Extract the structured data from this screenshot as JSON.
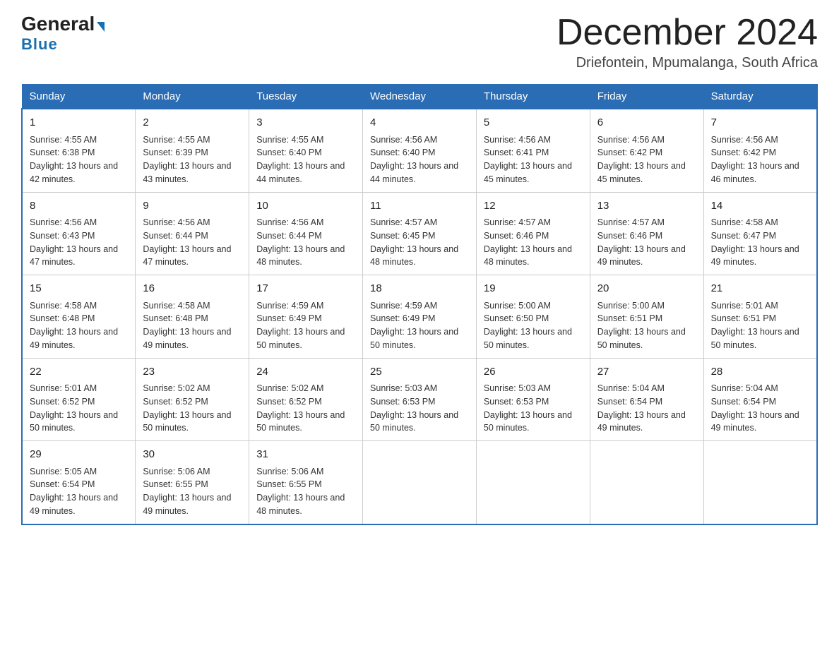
{
  "header": {
    "logo_general": "General",
    "logo_blue": "Blue",
    "month_year": "December 2024",
    "location": "Driefontein, Mpumalanga, South Africa"
  },
  "days_of_week": [
    "Sunday",
    "Monday",
    "Tuesday",
    "Wednesday",
    "Thursday",
    "Friday",
    "Saturday"
  ],
  "weeks": [
    [
      {
        "day": 1,
        "sunrise": "4:55 AM",
        "sunset": "6:38 PM",
        "daylight": "13 hours and 42 minutes."
      },
      {
        "day": 2,
        "sunrise": "4:55 AM",
        "sunset": "6:39 PM",
        "daylight": "13 hours and 43 minutes."
      },
      {
        "day": 3,
        "sunrise": "4:55 AM",
        "sunset": "6:40 PM",
        "daylight": "13 hours and 44 minutes."
      },
      {
        "day": 4,
        "sunrise": "4:56 AM",
        "sunset": "6:40 PM",
        "daylight": "13 hours and 44 minutes."
      },
      {
        "day": 5,
        "sunrise": "4:56 AM",
        "sunset": "6:41 PM",
        "daylight": "13 hours and 45 minutes."
      },
      {
        "day": 6,
        "sunrise": "4:56 AM",
        "sunset": "6:42 PM",
        "daylight": "13 hours and 45 minutes."
      },
      {
        "day": 7,
        "sunrise": "4:56 AM",
        "sunset": "6:42 PM",
        "daylight": "13 hours and 46 minutes."
      }
    ],
    [
      {
        "day": 8,
        "sunrise": "4:56 AM",
        "sunset": "6:43 PM",
        "daylight": "13 hours and 47 minutes."
      },
      {
        "day": 9,
        "sunrise": "4:56 AM",
        "sunset": "6:44 PM",
        "daylight": "13 hours and 47 minutes."
      },
      {
        "day": 10,
        "sunrise": "4:56 AM",
        "sunset": "6:44 PM",
        "daylight": "13 hours and 48 minutes."
      },
      {
        "day": 11,
        "sunrise": "4:57 AM",
        "sunset": "6:45 PM",
        "daylight": "13 hours and 48 minutes."
      },
      {
        "day": 12,
        "sunrise": "4:57 AM",
        "sunset": "6:46 PM",
        "daylight": "13 hours and 48 minutes."
      },
      {
        "day": 13,
        "sunrise": "4:57 AM",
        "sunset": "6:46 PM",
        "daylight": "13 hours and 49 minutes."
      },
      {
        "day": 14,
        "sunrise": "4:58 AM",
        "sunset": "6:47 PM",
        "daylight": "13 hours and 49 minutes."
      }
    ],
    [
      {
        "day": 15,
        "sunrise": "4:58 AM",
        "sunset": "6:48 PM",
        "daylight": "13 hours and 49 minutes."
      },
      {
        "day": 16,
        "sunrise": "4:58 AM",
        "sunset": "6:48 PM",
        "daylight": "13 hours and 49 minutes."
      },
      {
        "day": 17,
        "sunrise": "4:59 AM",
        "sunset": "6:49 PM",
        "daylight": "13 hours and 50 minutes."
      },
      {
        "day": 18,
        "sunrise": "4:59 AM",
        "sunset": "6:49 PM",
        "daylight": "13 hours and 50 minutes."
      },
      {
        "day": 19,
        "sunrise": "5:00 AM",
        "sunset": "6:50 PM",
        "daylight": "13 hours and 50 minutes."
      },
      {
        "day": 20,
        "sunrise": "5:00 AM",
        "sunset": "6:51 PM",
        "daylight": "13 hours and 50 minutes."
      },
      {
        "day": 21,
        "sunrise": "5:01 AM",
        "sunset": "6:51 PM",
        "daylight": "13 hours and 50 minutes."
      }
    ],
    [
      {
        "day": 22,
        "sunrise": "5:01 AM",
        "sunset": "6:52 PM",
        "daylight": "13 hours and 50 minutes."
      },
      {
        "day": 23,
        "sunrise": "5:02 AM",
        "sunset": "6:52 PM",
        "daylight": "13 hours and 50 minutes."
      },
      {
        "day": 24,
        "sunrise": "5:02 AM",
        "sunset": "6:52 PM",
        "daylight": "13 hours and 50 minutes."
      },
      {
        "day": 25,
        "sunrise": "5:03 AM",
        "sunset": "6:53 PM",
        "daylight": "13 hours and 50 minutes."
      },
      {
        "day": 26,
        "sunrise": "5:03 AM",
        "sunset": "6:53 PM",
        "daylight": "13 hours and 50 minutes."
      },
      {
        "day": 27,
        "sunrise": "5:04 AM",
        "sunset": "6:54 PM",
        "daylight": "13 hours and 49 minutes."
      },
      {
        "day": 28,
        "sunrise": "5:04 AM",
        "sunset": "6:54 PM",
        "daylight": "13 hours and 49 minutes."
      }
    ],
    [
      {
        "day": 29,
        "sunrise": "5:05 AM",
        "sunset": "6:54 PM",
        "daylight": "13 hours and 49 minutes."
      },
      {
        "day": 30,
        "sunrise": "5:06 AM",
        "sunset": "6:55 PM",
        "daylight": "13 hours and 49 minutes."
      },
      {
        "day": 31,
        "sunrise": "5:06 AM",
        "sunset": "6:55 PM",
        "daylight": "13 hours and 48 minutes."
      },
      null,
      null,
      null,
      null
    ]
  ]
}
